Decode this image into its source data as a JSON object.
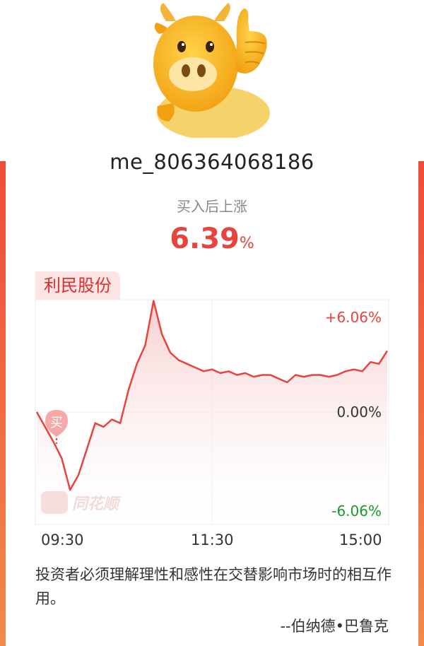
{
  "user": {
    "name": "me_806364068186"
  },
  "gain": {
    "label": "买入后上涨",
    "value": "6.39",
    "unit": "%"
  },
  "stock": {
    "name": "利民股份"
  },
  "chart": {
    "upper_label": "+6.06%",
    "mid_label": "0.00%",
    "lower_label": "-6.06%",
    "buy_marker": "买",
    "watermark": "同花顺",
    "time_labels": [
      "09:30",
      "11:30",
      "15:00"
    ]
  },
  "quote": {
    "text": "投资者必须理解理性和感性在交替影响市场时的相互作用。",
    "author": "--伯纳德•巴鲁克"
  },
  "chart_data": {
    "type": "line",
    "x_ticks": [
      "09:30",
      "11:30",
      "15:00"
    ],
    "ylim": [
      -6.06,
      6.06
    ],
    "y_ticks": [
      "+6.06%",
      "0.00%",
      "-6.06%"
    ],
    "series": [
      {
        "values": [
          0.0,
          -0.8,
          -1.6,
          -2.5,
          -4.2,
          -3.4,
          -2.0,
          -0.6,
          -0.8,
          -0.4,
          -0.6,
          1.2,
          2.6,
          3.6,
          6.0,
          4.2,
          3.2,
          2.8,
          2.6,
          2.4,
          2.2,
          2.3,
          2.1,
          2.2,
          2.0,
          2.1,
          1.9,
          2.0,
          2.0,
          1.8,
          1.6,
          2.0,
          1.9,
          2.0,
          2.0,
          1.9,
          2.0,
          2.2,
          2.3,
          2.2,
          2.7,
          2.6,
          3.3
        ]
      }
    ],
    "grid": true,
    "fill": "gradient-red"
  },
  "colors": {
    "accent": "#e8433d",
    "up": "#e8433d",
    "down": "#1a9a2e",
    "tag_bg": "#fde4e4"
  }
}
